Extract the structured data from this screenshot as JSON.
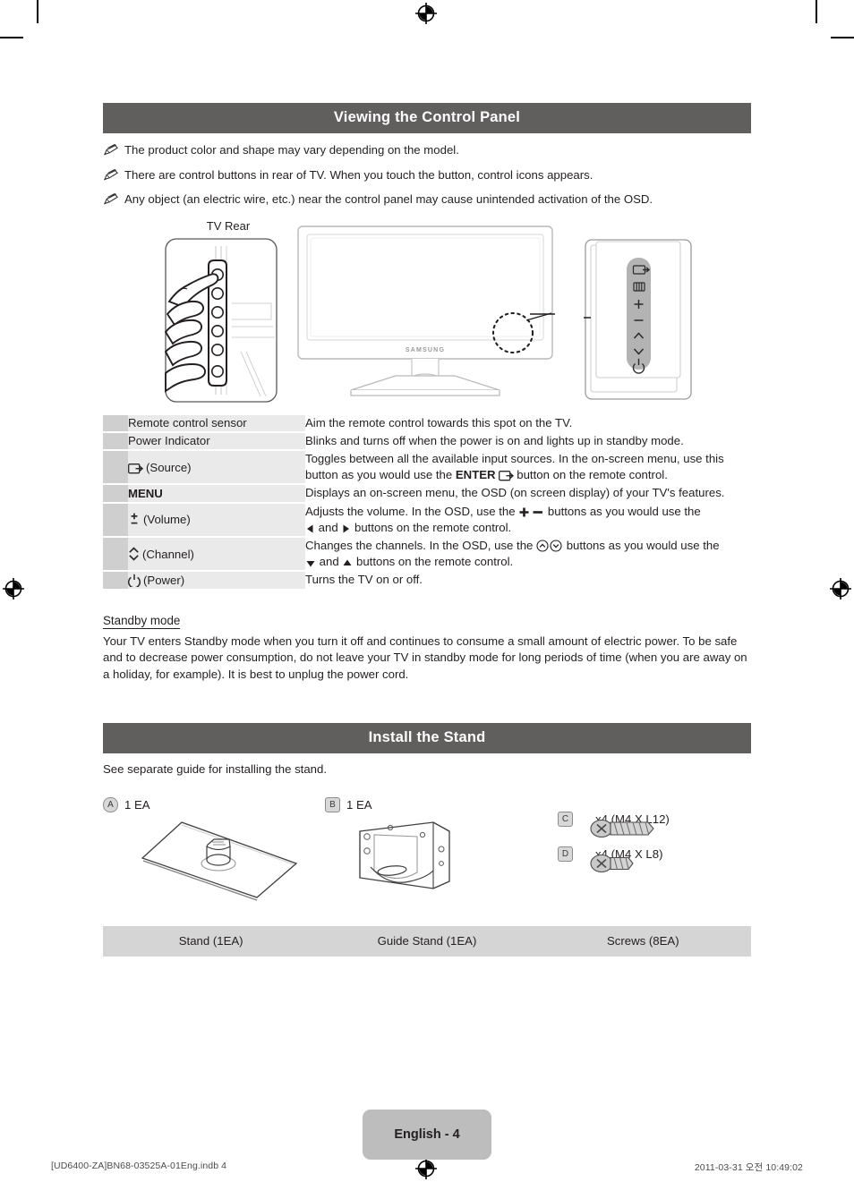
{
  "sections": {
    "control_panel": {
      "title": "Viewing the Control Panel",
      "notes": [
        "The product color and shape may vary depending on the model.",
        "There are control buttons in rear of TV. When you touch the button, control icons appears.",
        "Any object (an electric wire, etc.) near the control panel may cause unintended activation of the OSD."
      ],
      "illustration": {
        "tv_rear_label": "TV Rear",
        "brand_logo": "SAMSUNG",
        "panel_icons": [
          "source-icon",
          "menu-icon",
          "plus-icon",
          "minus-icon",
          "chevron-up-icon",
          "chevron-down-icon",
          "power-icon"
        ]
      },
      "table": [
        {
          "icon": "none",
          "label": "Remote control sensor",
          "bold": false,
          "desc": "Aim the remote control towards this spot on the TV."
        },
        {
          "icon": "none",
          "label": "Power Indicator",
          "bold": false,
          "desc": "Blinks and turns off when the power is on and lights up in standby mode."
        },
        {
          "icon": "source-icon",
          "label": "(Source)",
          "bold": false,
          "desc_pre": "Toggles between all the available input sources. In the on-screen menu, use this button as you would use the ",
          "desc_enter": "ENTER",
          "desc_post": " button on the remote control."
        },
        {
          "icon": "none",
          "label": "MENU",
          "bold": true,
          "desc": "Displays an on-screen menu, the OSD (on screen display) of your TV's features."
        },
        {
          "icon": "volume-icon",
          "label": "(Volume)",
          "bold": false,
          "desc_pre": "Adjusts the volume. In the OSD, use the ",
          "desc_mid": " buttons as you would use the ",
          "desc_post": " and ",
          "desc_end": " buttons on the remote control."
        },
        {
          "icon": "channel-icon",
          "label": "(Channel)",
          "bold": false,
          "desc_pre": "Changes the channels. In the OSD, use the ",
          "desc_mid": " buttons as you would use the ",
          "desc_post": " and ",
          "desc_end": " buttons on the remote control."
        },
        {
          "icon": "power-icon",
          "label": "(Power)",
          "bold": false,
          "desc": "Turns the TV on or off."
        }
      ],
      "standby": {
        "heading": "Standby mode",
        "body": "Your TV enters Standby mode when you turn it off and continues to consume a small amount of electric power. To be safe and to decrease power consumption, do not leave your TV in standby mode for long periods of time (when you are away on a holiday, for example). It is best to unplug the power cord."
      }
    },
    "install_stand": {
      "title": "Install the Stand",
      "note": "See separate guide for installing the stand.",
      "parts": [
        {
          "badge": "A",
          "qty": "1 EA",
          "name": "stand-part"
        },
        {
          "badge": "B",
          "qty": "1 EA",
          "name": "guide-stand-part"
        }
      ],
      "screws": [
        {
          "badge": "C",
          "spec": "x4 (M4 X L12)"
        },
        {
          "badge": "D",
          "spec": "x4 (M4 X L8)"
        }
      ],
      "captions": [
        "Stand (1EA)",
        "Guide Stand (1EA)",
        "Screws (8EA)"
      ]
    }
  },
  "footer": {
    "page_badge": "English - 4",
    "left": "[UD6400-ZA]BN68-03525A-01Eng.indb   4",
    "right": "2011-03-31   오전 10:49:02"
  },
  "colors": {
    "header_bar": "#615e5e",
    "row_label_bg": "#eaeaea",
    "row_swatch_bg": "#cfcfcf",
    "caption_bg": "#d5d5d5",
    "page_badge_bg": "#bdbdbd"
  }
}
